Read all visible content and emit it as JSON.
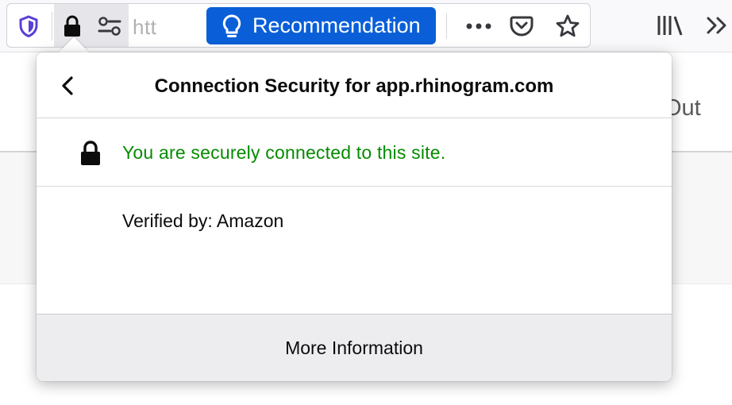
{
  "toolbar": {
    "url_text": "htt",
    "recommendation_label": "Recommendation"
  },
  "page": {
    "partial_text": "Out"
  },
  "popup": {
    "title": "Connection Security for app.rhinogram.com",
    "secure_message": "You are securely connected to this site.",
    "verified_by": "Verified by: Amazon",
    "more_info_label": "More Information"
  },
  "icons": {
    "shield": "tracking-protection-shield-icon",
    "lock": "padlock-icon",
    "permissions": "permissions-toggle-icon",
    "bulb": "lightbulb-icon",
    "more": "ellipsis-icon",
    "pocket": "pocket-icon",
    "star": "bookmark-star-icon",
    "library": "library-icon",
    "overflow": "chevron-double-right-icon",
    "back": "chevron-left-icon"
  },
  "colors": {
    "accent": "#0a5fd8",
    "secure_green": "#058b00",
    "shield_purple": "#5b3fd6"
  }
}
